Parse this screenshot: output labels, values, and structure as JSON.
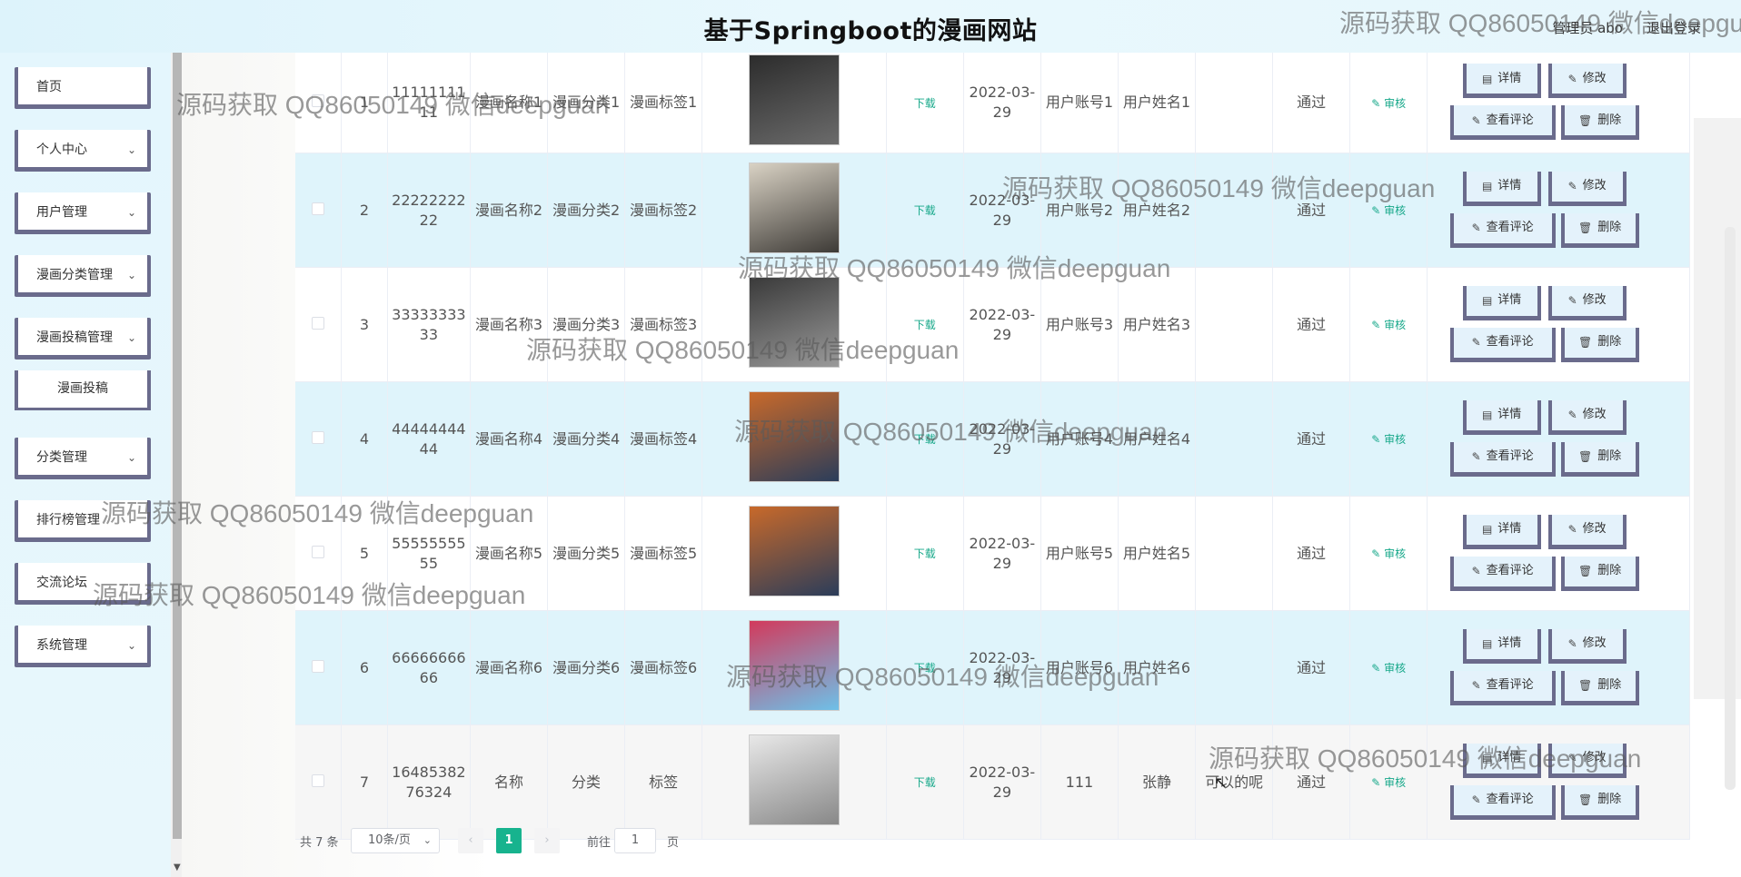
{
  "header": {
    "title": "基于Springboot的漫画网站",
    "user": "管理员 abo",
    "logout": "退出登录"
  },
  "sidebar": {
    "items": [
      {
        "label": "首页",
        "has_chevron": false
      },
      {
        "label": "个人中心",
        "has_chevron": true
      },
      {
        "label": "用户管理",
        "has_chevron": true
      },
      {
        "label": "漫画分类管理",
        "has_chevron": true
      },
      {
        "label": "漫画投稿管理",
        "has_chevron": true
      },
      {
        "label": "漫画投稿",
        "sub": true
      },
      {
        "label": "分类管理",
        "has_chevron": true
      },
      {
        "label": "排行榜管理",
        "has_chevron": false
      },
      {
        "label": "交流论坛",
        "has_chevron": false
      },
      {
        "label": "系统管理",
        "has_chevron": true
      }
    ]
  },
  "table": {
    "rows": [
      {
        "idx": "1",
        "no": "1111111111",
        "name": "漫画名称1",
        "cat": "漫画分类1",
        "tag": "漫画标签1",
        "download": "下载",
        "date": "2022-03-29",
        "account": "用户账号1",
        "username": "用户姓名1",
        "reply": "",
        "status": "通过",
        "audit": "审核"
      },
      {
        "idx": "2",
        "no": "2222222222",
        "name": "漫画名称2",
        "cat": "漫画分类2",
        "tag": "漫画标签2",
        "download": "下载",
        "date": "2022-03-29",
        "account": "用户账号2",
        "username": "用户姓名2",
        "reply": "",
        "status": "通过",
        "audit": "审核"
      },
      {
        "idx": "3",
        "no": "3333333333",
        "name": "漫画名称3",
        "cat": "漫画分类3",
        "tag": "漫画标签3",
        "download": "下载",
        "date": "2022-03-29",
        "account": "用户账号3",
        "username": "用户姓名3",
        "reply": "",
        "status": "通过",
        "audit": "审核"
      },
      {
        "idx": "4",
        "no": "4444444444",
        "name": "漫画名称4",
        "cat": "漫画分类4",
        "tag": "漫画标签4",
        "download": "下载",
        "date": "2022-03-29",
        "account": "用户账号4",
        "username": "用户姓名4",
        "reply": "",
        "status": "通过",
        "audit": "审核"
      },
      {
        "idx": "5",
        "no": "5555555555",
        "name": "漫画名称5",
        "cat": "漫画分类5",
        "tag": "漫画标签5",
        "download": "下载",
        "date": "2022-03-29",
        "account": "用户账号5",
        "username": "用户姓名5",
        "reply": "",
        "status": "通过",
        "audit": "审核"
      },
      {
        "idx": "6",
        "no": "6666666666",
        "name": "漫画名称6",
        "cat": "漫画分类6",
        "tag": "漫画标签6",
        "download": "下载",
        "date": "2022-03-29",
        "account": "用户账号6",
        "username": "用户姓名6",
        "reply": "",
        "status": "通过",
        "audit": "审核"
      },
      {
        "idx": "7",
        "no": "1648538276324",
        "name": "名称",
        "cat": "分类",
        "tag": "标签",
        "download": "下载",
        "date": "2022-03-29",
        "account": "111",
        "username": "张静",
        "reply": "可以的呢",
        "status": "通过",
        "audit": "审核"
      }
    ],
    "actions": {
      "detail": "详情",
      "edit": "修改",
      "comment": "查看评论",
      "delete": "删除"
    }
  },
  "pagination": {
    "total": "共 7 条",
    "page_size": "10条/页",
    "current": "1",
    "goto_label": "前往",
    "goto_value": "1",
    "page_suffix": "页"
  },
  "watermark": "源码获取 QQ86050149 微信deepguan",
  "colors": {
    "accent": "#17b38e",
    "row_alt": "#dff4fb",
    "button_border": "#6a6b8c"
  }
}
